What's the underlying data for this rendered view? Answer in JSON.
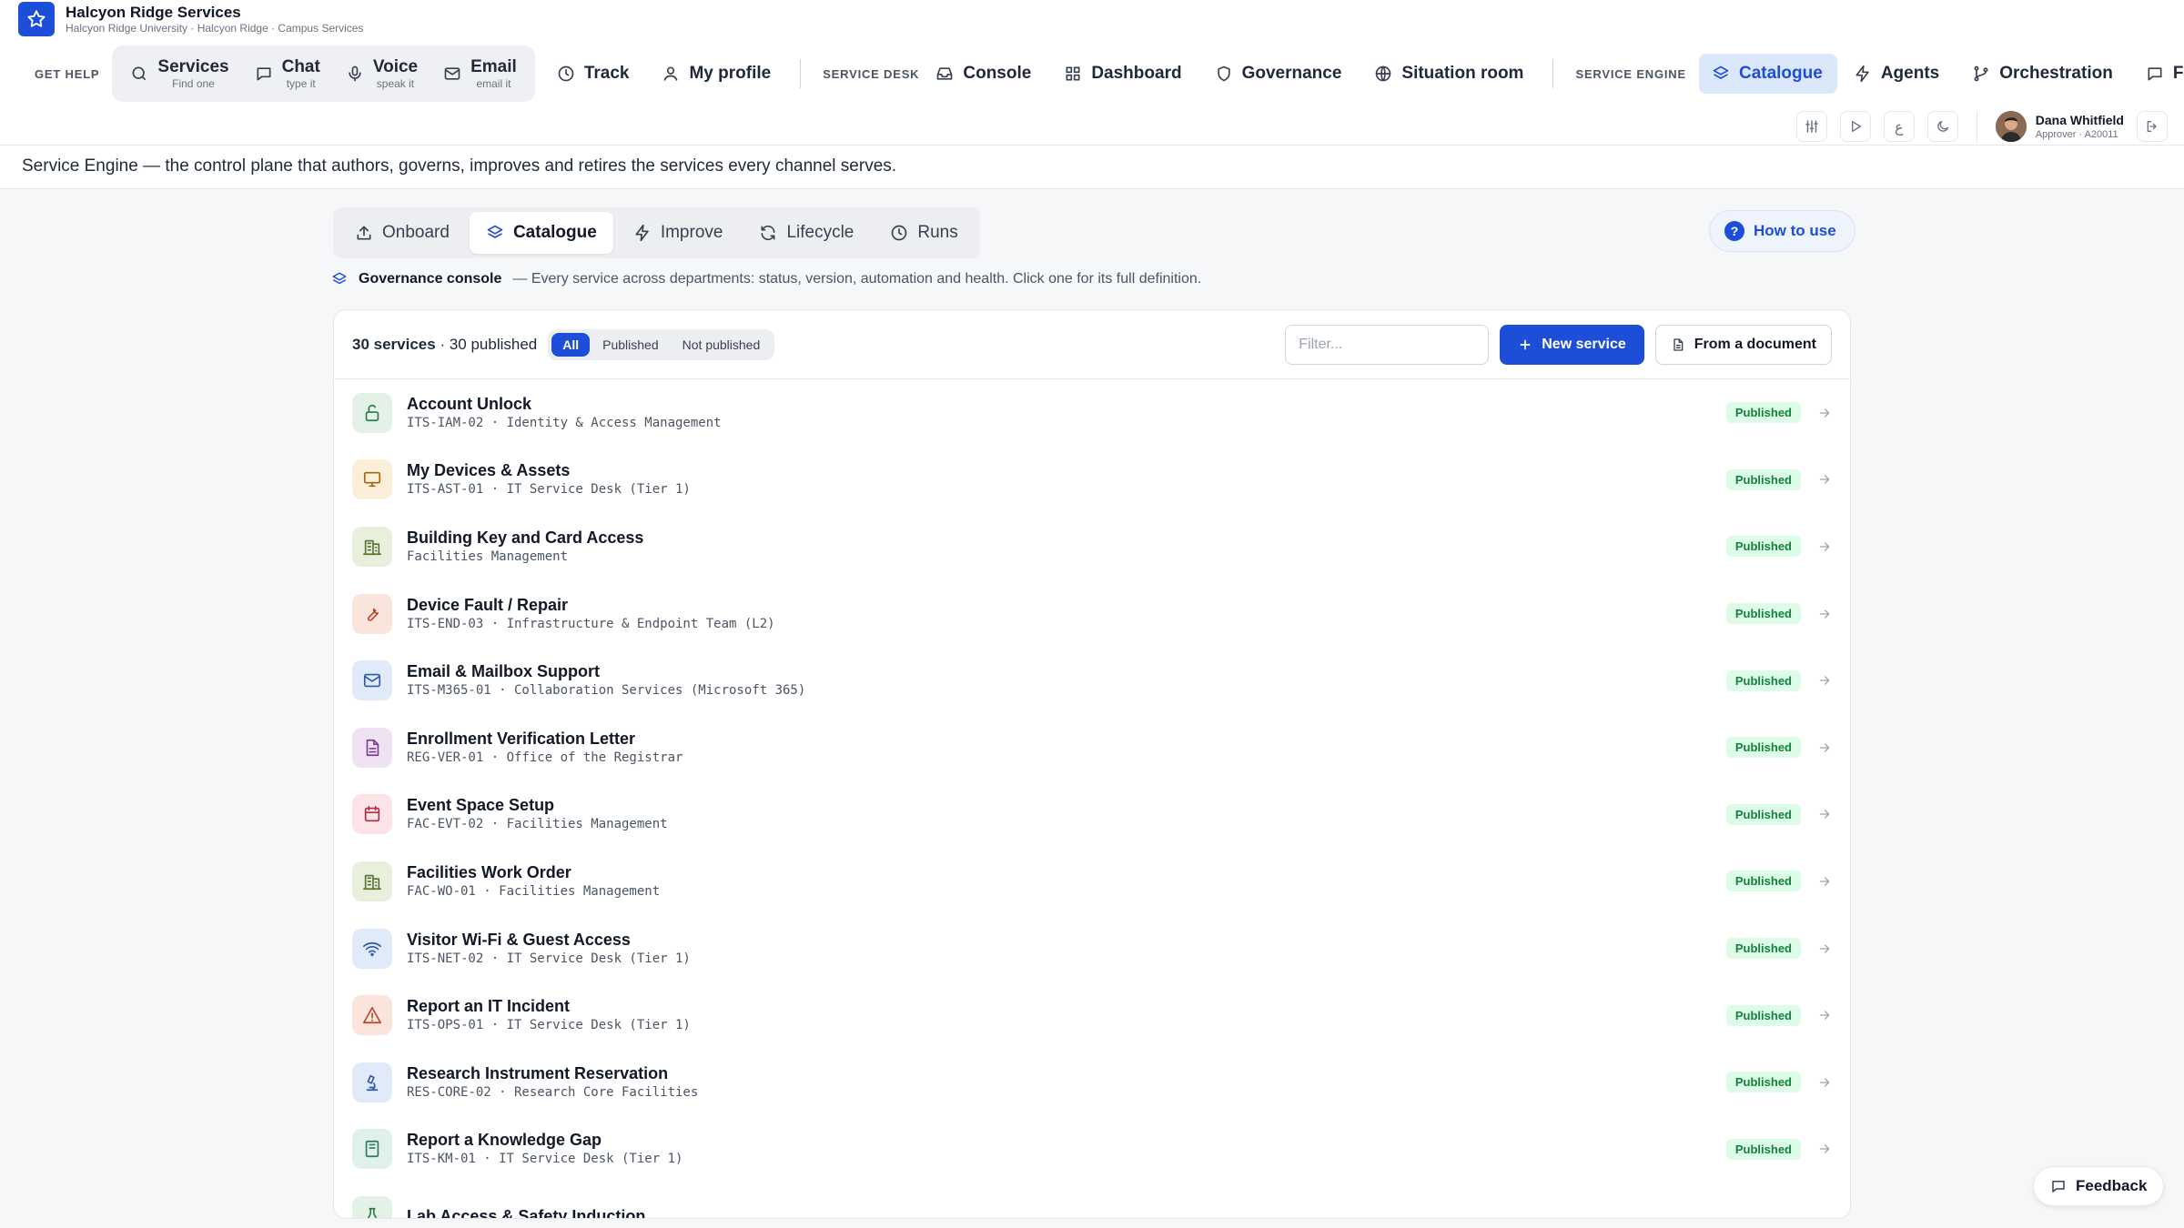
{
  "brand": {
    "title": "Halcyon Ridge Services",
    "subtitle": "Halcyon Ridge University · Halcyon Ridge · Campus Services",
    "icon": "star-icon"
  },
  "nav": {
    "get_help_label": "GET HELP",
    "get_help_items": [
      {
        "label": "Services",
        "sub": "Find one",
        "icon": "search-icon"
      },
      {
        "label": "Chat",
        "sub": "type it",
        "icon": "chat-icon"
      },
      {
        "label": "Voice",
        "sub": "speak it",
        "icon": "mic-icon"
      },
      {
        "label": "Email",
        "sub": "email it",
        "icon": "mail-icon"
      }
    ],
    "track": "Track",
    "my_profile": "My profile",
    "service_desk_label": "SERVICE DESK",
    "service_desk_items": [
      {
        "label": "Console",
        "icon": "inbox-icon"
      },
      {
        "label": "Dashboard",
        "icon": "grid-icon"
      },
      {
        "label": "Governance",
        "icon": "shield-icon"
      },
      {
        "label": "Situation room",
        "icon": "globe-icon"
      }
    ],
    "service_engine_label": "SERVICE ENGINE",
    "service_engine_items": [
      {
        "label": "Catalogue",
        "icon": "layers-icon",
        "active": true
      },
      {
        "label": "Agents",
        "icon": "bolt-icon"
      },
      {
        "label": "Orchestration",
        "icon": "branch-icon"
      },
      {
        "label": "F",
        "icon": "chat-icon"
      }
    ]
  },
  "user": {
    "name": "Dana Whitfield",
    "role": "Approver · A20011"
  },
  "tagline": "Service Engine — the control plane that authors, governs, improves and retires the services every channel serves.",
  "subtabs": [
    {
      "label": "Onboard",
      "icon": "upload-icon"
    },
    {
      "label": "Catalogue",
      "icon": "layers-icon",
      "active": true
    },
    {
      "label": "Improve",
      "icon": "bolt-icon"
    },
    {
      "label": "Lifecycle",
      "icon": "refresh-icon"
    },
    {
      "label": "Runs",
      "icon": "clock-icon"
    }
  ],
  "how_to_use": "How to use",
  "governance": {
    "title": "Governance console",
    "description": "— Every service across departments: status, version, automation and health. Click one for its full definition."
  },
  "panel": {
    "count_services": "30 services",
    "count_published": "· 30 published",
    "filters": [
      "All",
      "Published",
      "Not published"
    ],
    "active_filter": "All",
    "filter_placeholder": "Filter...",
    "new_service": "New service",
    "from_document": "From a document"
  },
  "services": [
    {
      "name": "Account Unlock",
      "meta": "ITS-IAM-02 · Identity & Access Management",
      "status": "Published",
      "icon": "unlock-icon",
      "bg": "#e3f1e6",
      "fg": "#2f7a45"
    },
    {
      "name": "My Devices & Assets",
      "meta": "ITS-AST-01 · IT Service Desk (Tier 1)",
      "status": "Published",
      "icon": "monitor-icon",
      "bg": "#fbefd9",
      "fg": "#a86414"
    },
    {
      "name": "Building Key and Card Access",
      "meta": "Facilities Management",
      "status": "Published",
      "icon": "building-icon",
      "bg": "#e8efdc",
      "fg": "#5b7332"
    },
    {
      "name": "Device Fault / Repair",
      "meta": "ITS-END-03 · Infrastructure & Endpoint Team (L2)",
      "status": "Published",
      "icon": "wrench-icon",
      "bg": "#fbe4dc",
      "fg": "#b8472a"
    },
    {
      "name": "Email & Mailbox Support",
      "meta": "ITS-M365-01 · Collaboration Services (Microsoft 365)",
      "status": "Published",
      "icon": "mail-icon",
      "bg": "#e1eaf8",
      "fg": "#2f5aa8"
    },
    {
      "name": "Enrollment Verification Letter",
      "meta": "REG-VER-01 · Office of the Registrar",
      "status": "Published",
      "icon": "document-icon",
      "bg": "#efe3f3",
      "fg": "#7b3f93"
    },
    {
      "name": "Event Space Setup",
      "meta": "FAC-EVT-02 · Facilities Management",
      "status": "Published",
      "icon": "calendar-icon",
      "bg": "#fbe3e6",
      "fg": "#b32d47"
    },
    {
      "name": "Facilities Work Order",
      "meta": "FAC-WO-01 · Facilities Management",
      "status": "Published",
      "icon": "building-icon",
      "bg": "#e8efdc",
      "fg": "#5b7332"
    },
    {
      "name": "Visitor Wi-Fi & Guest Access",
      "meta": "ITS-NET-02 · IT Service Desk (Tier 1)",
      "status": "Published",
      "icon": "wifi-icon",
      "bg": "#e1eaf8",
      "fg": "#2f5aa8"
    },
    {
      "name": "Report an IT Incident",
      "meta": "ITS-OPS-01 · IT Service Desk (Tier 1)",
      "status": "Published",
      "icon": "warning-icon",
      "bg": "#fbe4dc",
      "fg": "#b8472a"
    },
    {
      "name": "Research Instrument Reservation",
      "meta": "RES-CORE-02 · Research Core Facilities",
      "status": "Published",
      "icon": "microscope-icon",
      "bg": "#e1eaf8",
      "fg": "#2f5aa8"
    },
    {
      "name": "Report a Knowledge Gap",
      "meta": "ITS-KM-01 · IT Service Desk (Tier 1)",
      "status": "Published",
      "icon": "book-icon",
      "bg": "#dff1ea",
      "fg": "#2c7a5b"
    },
    {
      "name": "Lab Access & Safety Induction",
      "meta": "",
      "status": "",
      "icon": "flask-icon",
      "bg": "#e3f1e6",
      "fg": "#2f7a45"
    }
  ],
  "feedback": "Feedback",
  "colors": {
    "accent": "#1d4ed8",
    "published_bg": "#dcfce7",
    "published_fg": "#15803d"
  }
}
